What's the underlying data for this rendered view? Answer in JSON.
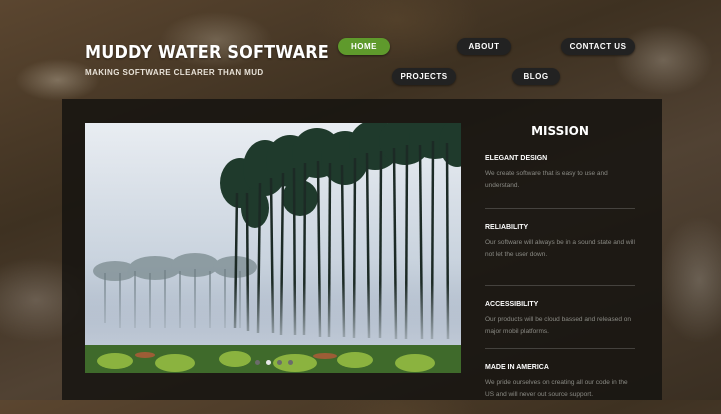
{
  "site": {
    "title": "MUDDY WATER SOFTWARE",
    "tagline": "MAKING SOFTWARE CLEARER THAN MUD"
  },
  "nav": {
    "items": [
      {
        "label": "HOME",
        "active": true
      },
      {
        "label": "ABOUT",
        "active": false
      },
      {
        "label": "CONTACT US",
        "active": false
      },
      {
        "label": "PROJECTS",
        "active": false
      },
      {
        "label": "BLOG",
        "active": false
      }
    ]
  },
  "slider": {
    "slide_count": 4,
    "active_slide": 2
  },
  "mission": {
    "title": "MISSION",
    "items": [
      {
        "heading": "ELEGANT DESIGN",
        "text": "We create software that is easy to use and understand."
      },
      {
        "heading": "RELIABILITY",
        "text": "Our software will always be in a sound state and will not let the user down."
      },
      {
        "heading": "ACCESSIBILITY",
        "text": "Our products will be cloud bassed and released on major mobil platforms."
      },
      {
        "heading": "MADE IN AMERICA",
        "text": "We pride ourselves on creating all our code in the US and will never out source support."
      }
    ]
  },
  "colors": {
    "nav_active": "#5f9a2c",
    "nav_default": "#222222",
    "panel": "rgba(22,20,16,0.86)"
  }
}
